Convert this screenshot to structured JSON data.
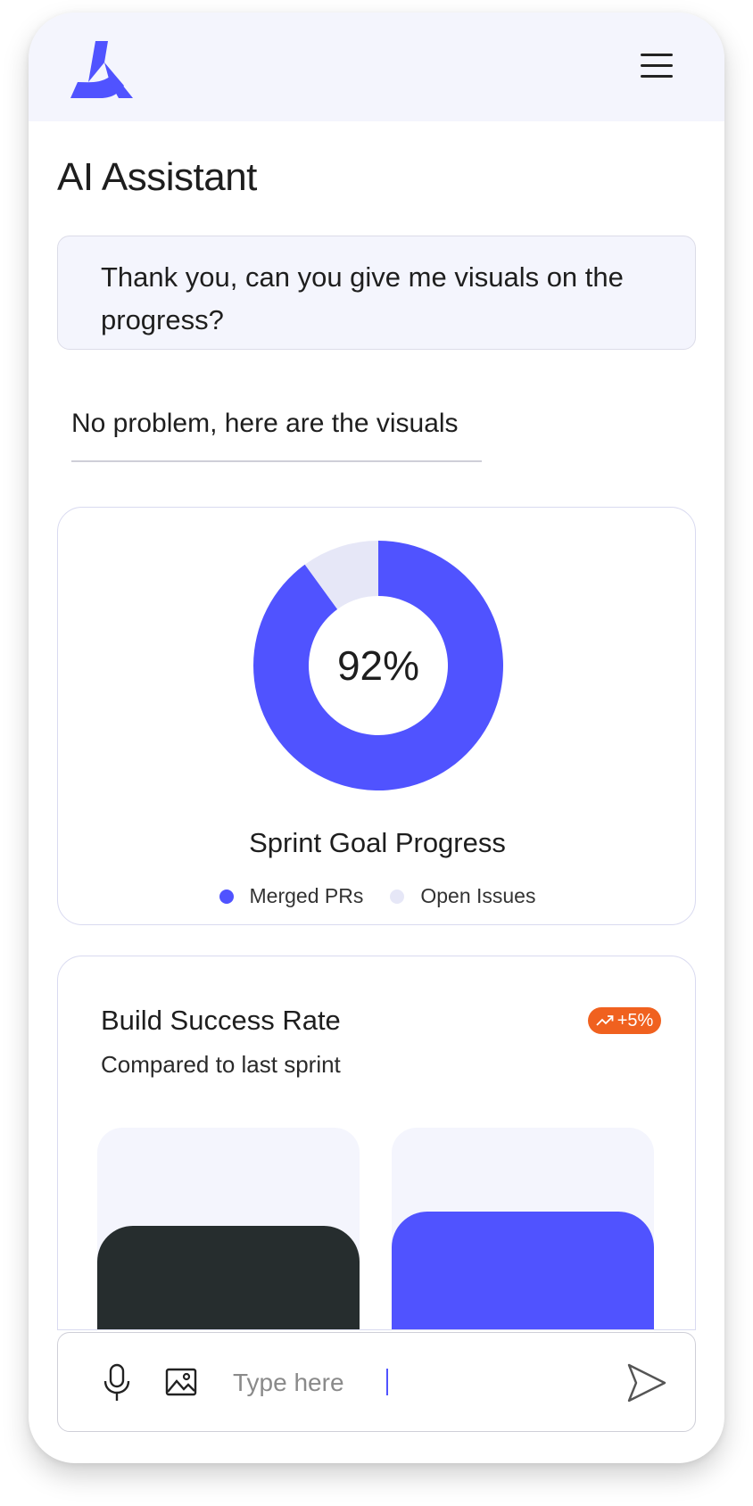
{
  "app": {
    "title": "AI Assistant",
    "colors": {
      "accent": "#5053ff",
      "accent_light": "#e6e7f7",
      "header_bg": "#f4f5fd",
      "dark_bar": "#262d2e",
      "badge": "#f0611f"
    }
  },
  "header": {
    "logo_icon": "triangle-logo-icon",
    "menu_icon": "hamburger-menu-icon"
  },
  "conversation": {
    "user_message": "Thank you, can you give me visuals on the progress?",
    "assistant_message": "No problem, here are the visuals"
  },
  "sprint_card": {
    "title": "Sprint Goal Progress",
    "center_label": "92%",
    "chart_data": {
      "type": "pie",
      "title": "Sprint Goal Progress",
      "center_label": "92%",
      "slices": [
        {
          "name": "Merged PRs",
          "value": 90,
          "color": "#5053ff"
        },
        {
          "name": "Open Issues",
          "value": 10,
          "color": "#e6e7f7"
        }
      ],
      "legend_position": "bottom"
    },
    "legend": [
      {
        "label": "Merged PRs",
        "color": "#5053ff"
      },
      {
        "label": "Open Issues",
        "color": "#e6e7f7"
      }
    ]
  },
  "build_card": {
    "title": "Build Success Rate",
    "subtitle": "Compared to last sprint",
    "badge": "+5%",
    "badge_icon": "trend-up-icon",
    "chart_data": {
      "type": "bar",
      "categories": [
        "",
        ""
      ],
      "values": [
        82,
        92
      ],
      "colors": [
        "#262d2e",
        "#5053ff"
      ],
      "ylim": [
        0,
        100
      ],
      "grid": false
    }
  },
  "composer": {
    "placeholder": "Type here",
    "value": "",
    "mic_icon": "microphone-icon",
    "image_icon": "image-icon",
    "send_icon": "send-icon"
  }
}
